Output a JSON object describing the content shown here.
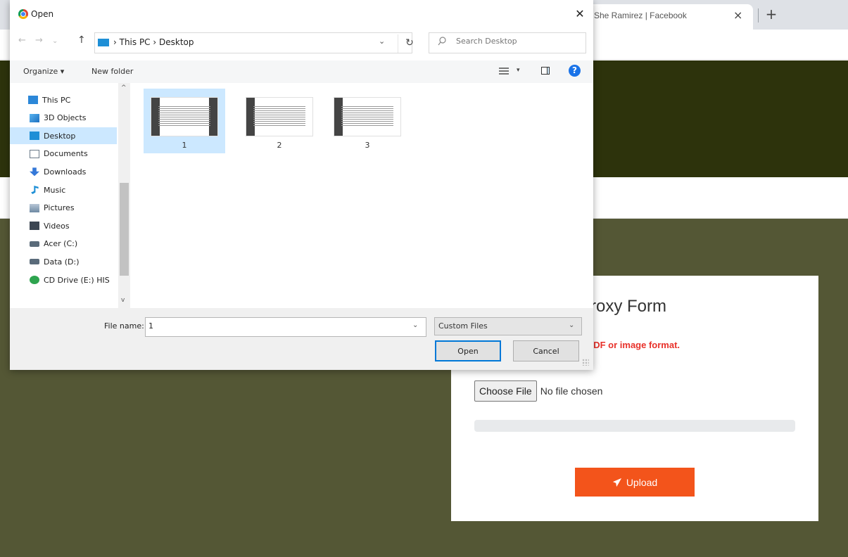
{
  "browser": {
    "tab_title": "She Ramirez | Facebook",
    "tab_close": "×",
    "new_tab": "+"
  },
  "page": {
    "form_title": "Proxy Form",
    "form_note": "n PDF or image format.",
    "choose_file_label": "Choose File",
    "file_status": "No file chosen",
    "upload_progress": 0,
    "upload_label": "Upload",
    "accent_color": "#f3541b",
    "note_color": "#e8312a"
  },
  "dialog": {
    "title": "Open",
    "close": "✕",
    "nav": {
      "back": "←",
      "forward": "→",
      "recent": "⌄",
      "up": "↑"
    },
    "breadcrumb": "› This PC › Desktop",
    "address_dropdown": "⌄",
    "refresh": "↻",
    "search_placeholder": "Search Desktop",
    "toolbar": {
      "organize": "Organize ▾",
      "new_folder": "New folder",
      "view_chevron": "▾",
      "help": "?"
    },
    "nav_items": [
      {
        "label": "This PC",
        "icon": "pc-icon"
      },
      {
        "label": "3D Objects",
        "icon": "3d-objects-icon"
      },
      {
        "label": "Desktop",
        "icon": "desktop-icon"
      },
      {
        "label": "Documents",
        "icon": "documents-icon"
      },
      {
        "label": "Downloads",
        "icon": "downloads-icon"
      },
      {
        "label": "Music",
        "icon": "music-icon"
      },
      {
        "label": "Pictures",
        "icon": "pictures-icon"
      },
      {
        "label": "Videos",
        "icon": "videos-icon"
      },
      {
        "label": "Acer (C:)",
        "icon": "drive-icon"
      },
      {
        "label": "Data (D:)",
        "icon": "drive-icon"
      },
      {
        "label": "CD Drive (E:) HIS",
        "icon": "cd-drive-icon"
      }
    ],
    "selected_nav": "Desktop",
    "files": [
      {
        "name": "1"
      },
      {
        "name": "2"
      },
      {
        "name": "3"
      }
    ],
    "selected_file": "1",
    "file_name_label": "File name:",
    "file_name_value": "1",
    "file_type": "Custom Files",
    "open_label": "Open",
    "cancel_label": "Cancel"
  }
}
